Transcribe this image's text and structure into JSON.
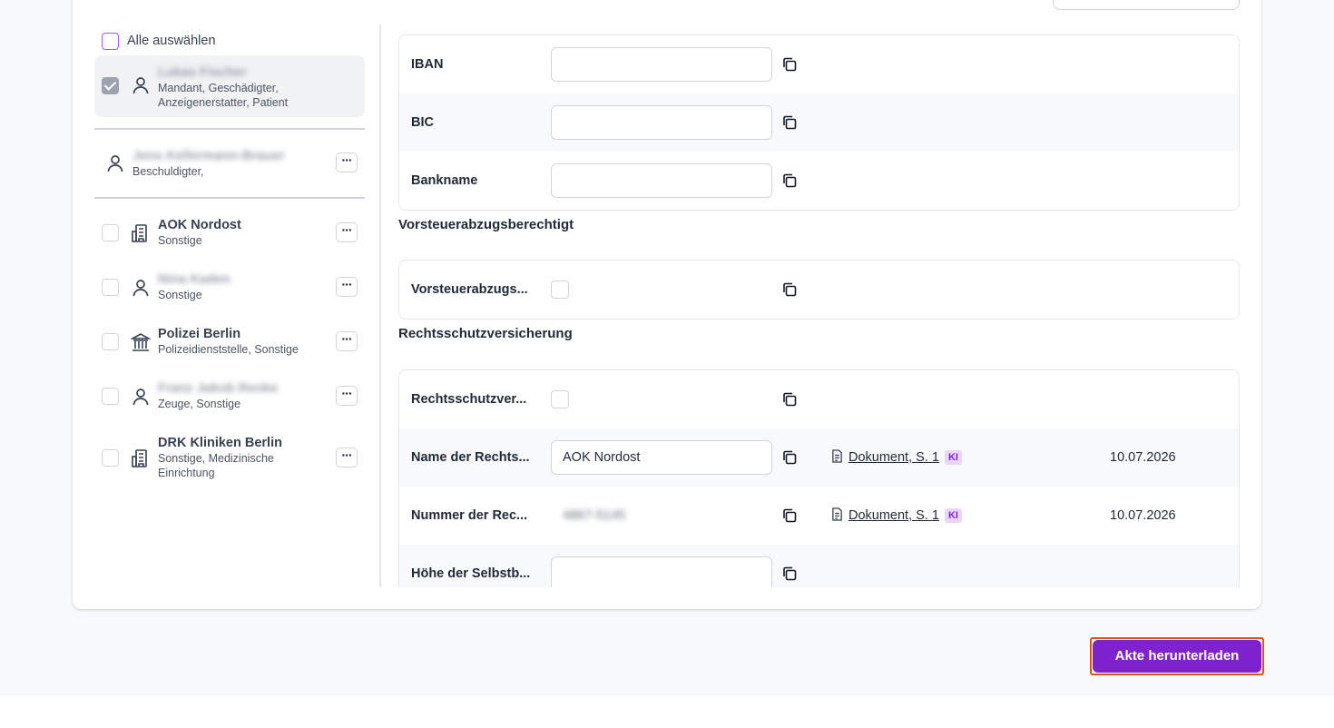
{
  "sidebar": {
    "select_all_label": "Alle auswählen",
    "parties": [
      {
        "name": "Lukas Fischer",
        "roles": "Mandant, Geschädigter, Anzeigenerstatter, Patient",
        "icon": "person-icon",
        "checked": true,
        "name_redacted": true
      },
      {
        "name": "Jens Kellermann-Brauer",
        "roles": "Beschuldigter,",
        "icon": "person-icon",
        "checked": false,
        "name_redacted": true
      },
      {
        "name": "AOK Nordost",
        "roles": "Sonstige",
        "icon": "building-icon",
        "checked": false
      },
      {
        "name": "Nina Kaden",
        "roles": "Sonstige",
        "icon": "person-icon",
        "checked": false,
        "name_redacted": true
      },
      {
        "name": "Polizei Berlin",
        "roles": "Polizeidienststelle, Sonstige",
        "icon": "government-building-icon",
        "checked": false
      },
      {
        "name": "Franz Jakob Renke",
        "roles": "Zeuge, Sonstige",
        "icon": "person-icon",
        "checked": false,
        "name_redacted": true
      },
      {
        "name": "DRK Kliniken Berlin",
        "roles": "Sonstige, Medizinische Einrichtung",
        "icon": "building-icon",
        "checked": false
      }
    ],
    "more_label": "···"
  },
  "bank": {
    "rows": [
      {
        "label": "IBAN",
        "value": ""
      },
      {
        "label": "BIC",
        "value": ""
      },
      {
        "label": "Bankname",
        "value": ""
      }
    ]
  },
  "vorsteuer": {
    "title": "Vorsteuerabzugsberechtigt",
    "row_label": "Vorsteuerabzugs..."
  },
  "rechtsschutz": {
    "title": "Rechtsschutzversicherung",
    "rows": [
      {
        "label": "Rechtsschutzver...",
        "type": "checkbox"
      },
      {
        "label": "Name der Rechts...",
        "value": "AOK Nordost",
        "source": "Dokument, S. 1",
        "badge": "KI",
        "date": "10.07.2026"
      },
      {
        "label": "Nummer der Rec...",
        "value": "4867-5145",
        "source": "Dokument, S. 1",
        "badge": "KI",
        "date": "10.07.2026",
        "value_redacted": true
      },
      {
        "label": "Höhe der Selbstb...",
        "value": ""
      }
    ]
  },
  "footer": {
    "download_label": "Akte herunterladen"
  },
  "colors": {
    "accent": "#7e22ce",
    "badge_bg": "#ead5fb",
    "focus_outline": "#e5501a"
  }
}
